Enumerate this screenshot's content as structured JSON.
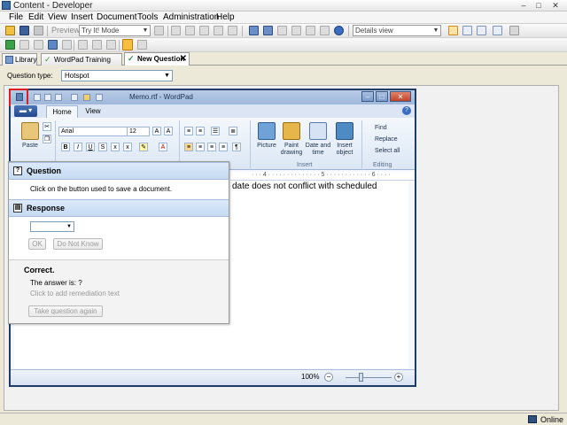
{
  "window": {
    "title": "Content - Developer",
    "buttons": [
      "–",
      "□",
      "✕"
    ]
  },
  "menu": {
    "items": [
      "File",
      "Edit",
      "View",
      "Insert",
      "Document",
      "Tools",
      "Administration",
      "Help"
    ]
  },
  "toolbar": {
    "preview_label": "Preview",
    "mode_combo": "Try It! Mode",
    "view_combo": "Details view"
  },
  "tabs": {
    "items": [
      {
        "label": "Library"
      },
      {
        "label": "WordPad Training"
      },
      {
        "label": "New Question"
      }
    ],
    "close_glyph": "✕"
  },
  "question_type": {
    "label": "Question type:",
    "value": "Hotspot"
  },
  "wordpad": {
    "title": "Memo.rtf - WordPad",
    "ribbon_tabs": [
      "Home",
      "View"
    ],
    "font_name": "Arial",
    "font_size": "12",
    "paste_label": "Paste",
    "insert_items": [
      "Picture",
      "Paint drawing",
      "Date and time",
      "Insert object"
    ],
    "insert_group": "Insert",
    "editing_items": [
      "Find",
      "Replace",
      "Select all"
    ],
    "editing_group": "Editing",
    "doc_text": "date does not conflict with scheduled",
    "zoom": "100%"
  },
  "question_panel": {
    "question_header": "Question",
    "question_text": "Click on the button used to save a document.",
    "response_header": "Response",
    "ok_label": "OK",
    "dont_know_label": "Do Not Know",
    "correct_label": "Correct.",
    "answer_label": "The answer is: ?",
    "remediation_placeholder": "Click to add remediation text",
    "retake_label": "Take question again"
  },
  "status": {
    "online": "Online"
  },
  "colors": {
    "highlight": "#e01e1e",
    "section_header": "#c5daf3"
  }
}
